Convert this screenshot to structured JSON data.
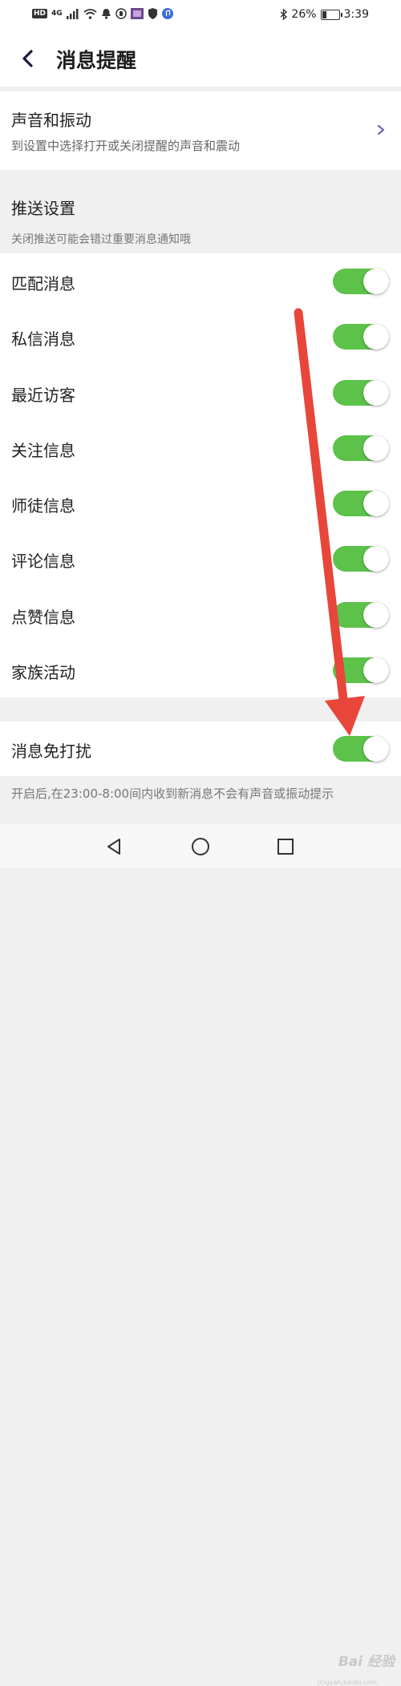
{
  "status_bar": {
    "left_badge": "HD",
    "network": "4G",
    "battery_percent": "26%",
    "battery_level": 0.26,
    "time": "3:39"
  },
  "header": {
    "title": "消息提醒",
    "back_icon": "chevron-left-icon"
  },
  "sound_section": {
    "title": "声音和振动",
    "subtitle": "到设置中选择打开或关闭提醒的声音和震动"
  },
  "push_section": {
    "title": "推送设置",
    "subtitle": "关闭推送可能会错过重要消息通知哦"
  },
  "toggles": [
    {
      "label": "匹配消息",
      "on": true
    },
    {
      "label": "私信消息",
      "on": true
    },
    {
      "label": "最近访客",
      "on": true
    },
    {
      "label": "关注信息",
      "on": true
    },
    {
      "label": "师徒信息",
      "on": true
    },
    {
      "label": "评论信息",
      "on": true
    },
    {
      "label": "点赞信息",
      "on": true
    },
    {
      "label": "家族活动",
      "on": true
    }
  ],
  "dnd": {
    "label": "消息免打扰",
    "on": true,
    "note": "开启后,在23:00-8:00间内收到新消息不会有声音或振动提示"
  },
  "watermark": {
    "text": "Bai 经验",
    "sub": "jingyan.baidu.com"
  },
  "colors": {
    "switch_on": "#5cc24a",
    "annotation_arrow": "#e8463a",
    "chevron": "#6b6bb0"
  }
}
